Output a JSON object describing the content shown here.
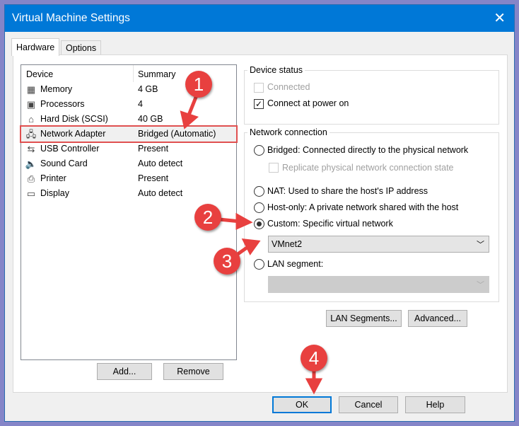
{
  "window": {
    "title": "Virtual Machine Settings",
    "close_icon": "✕"
  },
  "tabs": [
    {
      "label": "Hardware",
      "active": true
    },
    {
      "label": "Options",
      "active": false
    }
  ],
  "device_list": {
    "headers": {
      "device": "Device",
      "summary": "Summary"
    },
    "items": [
      {
        "icon": "memory-icon",
        "glyph": "▦",
        "name": "Memory",
        "summary": "4 GB"
      },
      {
        "icon": "processor-icon",
        "glyph": "▣",
        "name": "Processors",
        "summary": "4"
      },
      {
        "icon": "hard-disk-icon",
        "glyph": "⌂",
        "name": "Hard Disk (SCSI)",
        "summary": "40 GB"
      },
      {
        "icon": "network-adapter-icon",
        "glyph": "🖧",
        "name": "Network Adapter",
        "summary": "Bridged (Automatic)",
        "selected": true
      },
      {
        "icon": "usb-icon",
        "glyph": "⇆",
        "name": "USB Controller",
        "summary": "Present"
      },
      {
        "icon": "sound-icon",
        "glyph": "🔈",
        "name": "Sound Card",
        "summary": "Auto detect"
      },
      {
        "icon": "printer-icon",
        "glyph": "⎙",
        "name": "Printer",
        "summary": "Present"
      },
      {
        "icon": "display-icon",
        "glyph": "▭",
        "name": "Display",
        "summary": "Auto detect"
      }
    ],
    "add_label": "Add...",
    "remove_label": "Remove"
  },
  "device_status": {
    "title": "Device status",
    "connected": {
      "label": "Connected",
      "checked": false,
      "enabled": false
    },
    "connect_at_power_on": {
      "label": "Connect at power on",
      "checked": true
    }
  },
  "network_connection": {
    "title": "Network connection",
    "bridged": "Bridged: Connected directly to the physical network",
    "replicate": "Replicate physical network connection state",
    "nat": "NAT: Used to share the host's IP address",
    "host_only": "Host-only: A private network shared with the host",
    "custom": "Custom: Specific virtual network",
    "custom_value": "VMnet2",
    "lan_segment": "LAN segment:",
    "lan_segment_value": "",
    "selected": "custom"
  },
  "buttons": {
    "lan_segments": "LAN Segments...",
    "advanced": "Advanced...",
    "ok": "OK",
    "cancel": "Cancel",
    "help": "Help"
  },
  "callouts": [
    "1",
    "2",
    "3",
    "4"
  ],
  "colors": {
    "accent": "#0078d7",
    "callout": "#e8403f"
  }
}
